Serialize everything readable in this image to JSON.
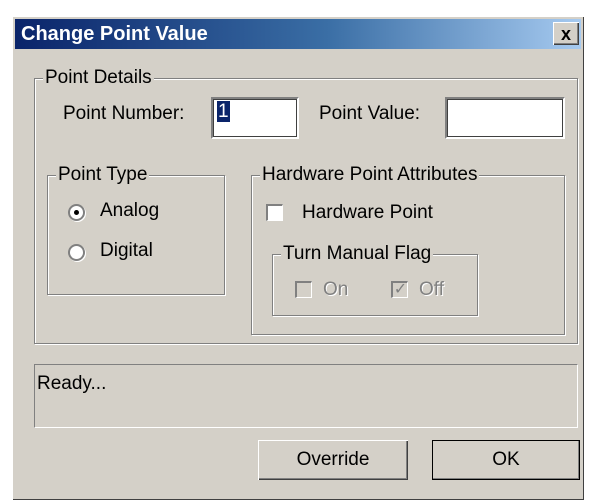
{
  "window": {
    "title": "Change Point Value",
    "close_symbol": "x"
  },
  "point_details": {
    "legend": "Point Details",
    "point_number_label": "Point Number:",
    "point_number_value": "1",
    "point_value_label": "Point Value:",
    "point_value_value": ""
  },
  "point_type": {
    "legend": "Point Type",
    "options": [
      {
        "label": "Analog",
        "selected": true
      },
      {
        "label": "Digital",
        "selected": false
      }
    ]
  },
  "hardware": {
    "legend": "Hardware Point Attributes",
    "hardware_point_label": "Hardware Point",
    "hardware_point_checked": false,
    "manual_flag": {
      "legend": "Turn Manual Flag",
      "on_label": "On",
      "on_checked": false,
      "off_label": "Off",
      "off_checked": true,
      "enabled": false
    }
  },
  "status": {
    "text": "Ready..."
  },
  "buttons": {
    "override": "Override",
    "ok": "OK"
  }
}
